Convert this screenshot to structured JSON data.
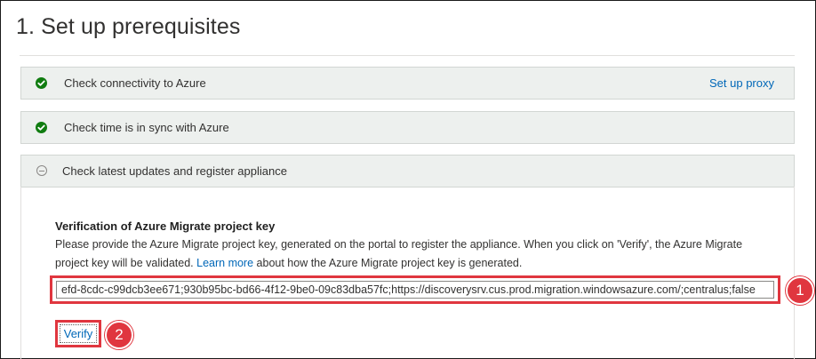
{
  "page": {
    "title": "1. Set up prerequisites"
  },
  "steps": [
    {
      "label": "Check connectivity to Azure",
      "status": "success",
      "action_link": "Set up proxy"
    },
    {
      "label": "Check time is in sync with Azure",
      "status": "success"
    },
    {
      "label": "Check latest updates and register appliance",
      "status": "expanded"
    }
  ],
  "register": {
    "heading": "Verification of Azure Migrate project key",
    "description_1": "Please provide the Azure Migrate project key, generated on the portal to register the appliance. When you click on 'Verify', the Azure Migrate project key will be validated.",
    "learn_more": "Learn more",
    "description_2": "about how the Azure Migrate project key is generated.",
    "key_value": "efd-8cdc-c99dcb3ee671;930b95bc-bd66-4f12-9be0-09c83dba57fc;https://discoverysrv.cus.prod.migration.windowsazure.com/;centralus;false",
    "verify_label": "Verify"
  },
  "callouts": [
    "1",
    "2"
  ],
  "colors": {
    "success": "#107c10",
    "link": "#0067b8",
    "annotation": "#e0363f",
    "step_bg": "#edf0ee"
  },
  "icons": {
    "success": "check-circle-icon",
    "expanded": "collapse-circle-icon"
  }
}
